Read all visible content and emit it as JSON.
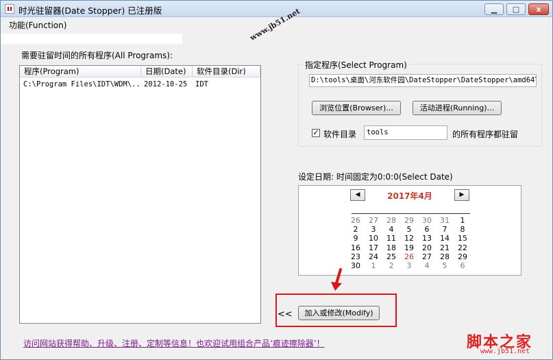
{
  "window": {
    "title": "时光驻留器(Date Stopper) 已注册版",
    "min_label": "▁",
    "max_label": "□",
    "close_label": "x"
  },
  "menu": {
    "function_label": "功能(Function)"
  },
  "programs": {
    "heading": "需要驻留时间的所有程序(All Programs):",
    "columns": [
      "程序(Program)",
      "日期(Date)",
      "软件目录(Dir)"
    ],
    "rows": [
      {
        "program": "C:\\Program Files\\IDT\\WDM\\...",
        "date": "2012-10-25",
        "dir": "IDT"
      }
    ]
  },
  "select_program": {
    "title": "指定程序(Select Program)",
    "path": "D:\\tools\\桌面\\河东软件园\\DateStopper\\DateStopper\\amd64\\",
    "browse_label": "浏览位置(Browser)...",
    "running_label": "活动进程(Running)...",
    "dir_checkbox_label": "软件目录",
    "dir_checkbox_mark": "✓",
    "dir_value": "tools",
    "dir_suffix": "的所有程序都驻留"
  },
  "date_setting": {
    "label": "设定日期: 时间固定为0:0:0(Select Date)",
    "calendar": {
      "title": "2017年4月",
      "prev": "◀",
      "next": "▶",
      "weeks": [
        [
          "26",
          "27",
          "28",
          "29",
          "30",
          "31",
          "1"
        ],
        [
          "2",
          "3",
          "4",
          "5",
          "6",
          "7",
          "8"
        ],
        [
          "9",
          "10",
          "11",
          "12",
          "13",
          "14",
          "15"
        ],
        [
          "16",
          "17",
          "18",
          "19",
          "20",
          "21",
          "22"
        ],
        [
          "23",
          "24",
          "25",
          "26",
          "27",
          "28",
          "29"
        ],
        [
          "30",
          "1",
          "2",
          "3",
          "4",
          "5",
          "6"
        ]
      ],
      "today": "26"
    }
  },
  "actions": {
    "collapse_label": "<<",
    "modify_label": "加入或修改(Modify)"
  },
  "footer": {
    "link_text": "访问网站获得帮助、升级、注册、定制等信息！也欢迎试用组合产品‘痕迹擦除器’！"
  },
  "watermarks": {
    "jb51": "www.jb51.net",
    "site_name": "脚本之家",
    "site_url": "www.jb51.net"
  },
  "colors": {
    "accent_red": "#d9161b",
    "calendar_title": "#c0392b",
    "link": "#7a1d8a"
  }
}
